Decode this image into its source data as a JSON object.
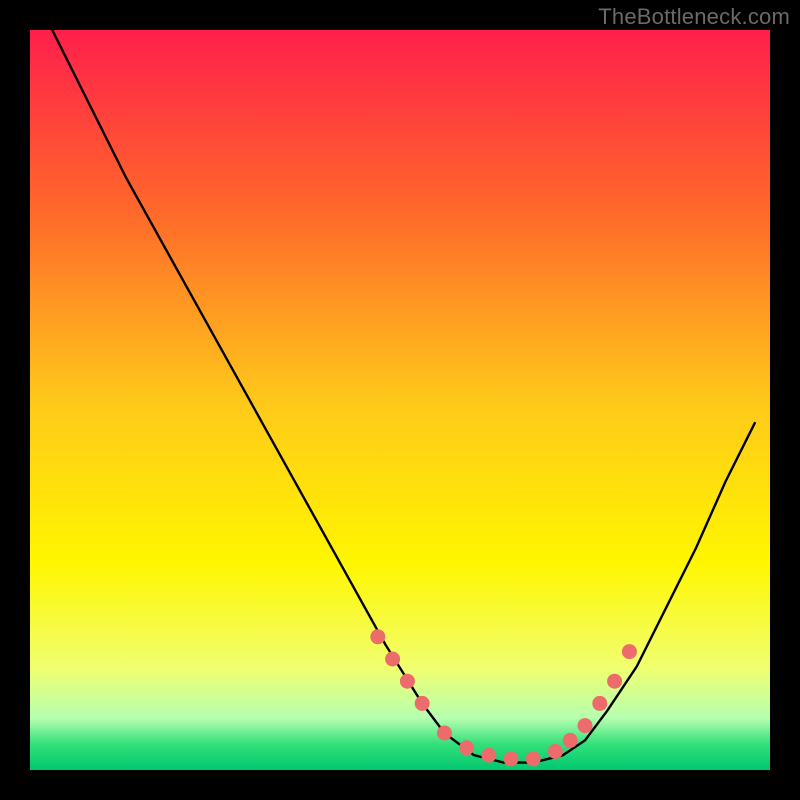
{
  "watermark": "TheBottleneck.com",
  "chart_data": {
    "type": "line",
    "title": "",
    "xlabel": "",
    "ylabel": "",
    "xlim": [
      0,
      100
    ],
    "ylim": [
      0,
      100
    ],
    "grid": false,
    "legend": false,
    "background_gradient": {
      "stops": [
        {
          "offset": 0.0,
          "color": "#ff1f4b"
        },
        {
          "offset": 0.25,
          "color": "#ff6a2a"
        },
        {
          "offset": 0.5,
          "color": "#ffc81a"
        },
        {
          "offset": 0.72,
          "color": "#fff600"
        },
        {
          "offset": 0.86,
          "color": "#f1ff6e"
        },
        {
          "offset": 0.93,
          "color": "#b6ffb0"
        },
        {
          "offset": 0.965,
          "color": "#33e07a"
        },
        {
          "offset": 1.0,
          "color": "#00c86e"
        }
      ]
    },
    "series": [
      {
        "name": "curve",
        "type": "line",
        "color": "#000000",
        "x": [
          3,
          8,
          13,
          18,
          23,
          28,
          33,
          38,
          43,
          48,
          53,
          56,
          60,
          64,
          68,
          72,
          75,
          78,
          82,
          86,
          90,
          94,
          98
        ],
        "y": [
          100,
          90,
          80,
          71,
          62,
          53,
          44,
          35,
          26,
          17,
          9,
          5,
          2,
          1,
          1,
          2,
          4,
          8,
          14,
          22,
          30,
          39,
          47
        ]
      },
      {
        "name": "markers",
        "type": "scatter",
        "color": "#ec6b6b",
        "x": [
          47,
          49,
          51,
          53,
          56,
          59,
          62,
          65,
          68,
          71,
          73,
          75,
          77,
          79,
          81
        ],
        "y": [
          18,
          15,
          12,
          9,
          5,
          3,
          2,
          1.5,
          1.5,
          2.5,
          4,
          6,
          9,
          12,
          16
        ]
      }
    ]
  }
}
